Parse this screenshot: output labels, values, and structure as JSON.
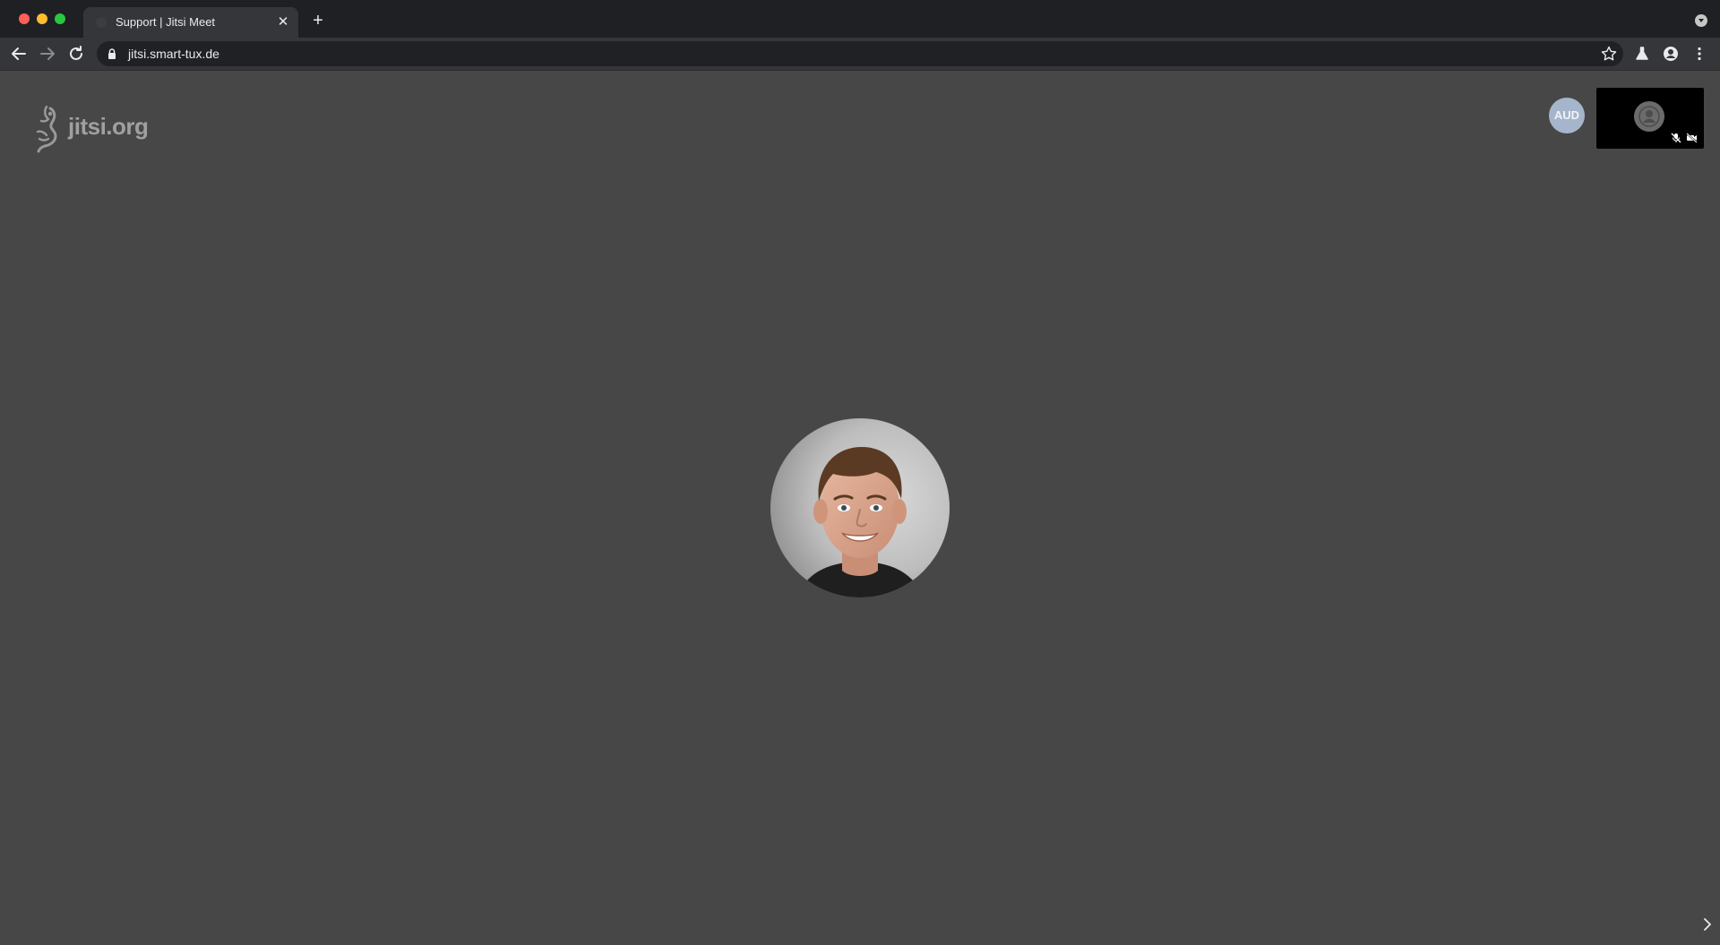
{
  "browser": {
    "tab": {
      "title": "Support | Jitsi Meet",
      "close_glyph": "✕"
    },
    "new_tab_glyph": "+",
    "address_bar": {
      "url": "jitsi.smart-tux.de"
    },
    "icons": {
      "back": "back-arrow-icon",
      "forward": "forward-arrow-icon",
      "reload": "reload-icon",
      "lock": "lock-icon",
      "star": "star-icon",
      "labs": "labs-flask-icon",
      "profile": "profile-icon",
      "menu": "kebab-menu-icon",
      "tab_search": "tab-search-icon"
    }
  },
  "conference": {
    "logo_text": "jitsi.org",
    "remote_badge": "AUD",
    "local_thumbnail": {
      "mic_muted": true,
      "camera_off": true
    },
    "dominant_speaker": "photo-avatar"
  },
  "colors": {
    "page_background": "#474747",
    "tabstrip": "#1f2023",
    "toolbar": "#35363a",
    "omnibox": "#202124",
    "badge": "#a5b5cb"
  }
}
